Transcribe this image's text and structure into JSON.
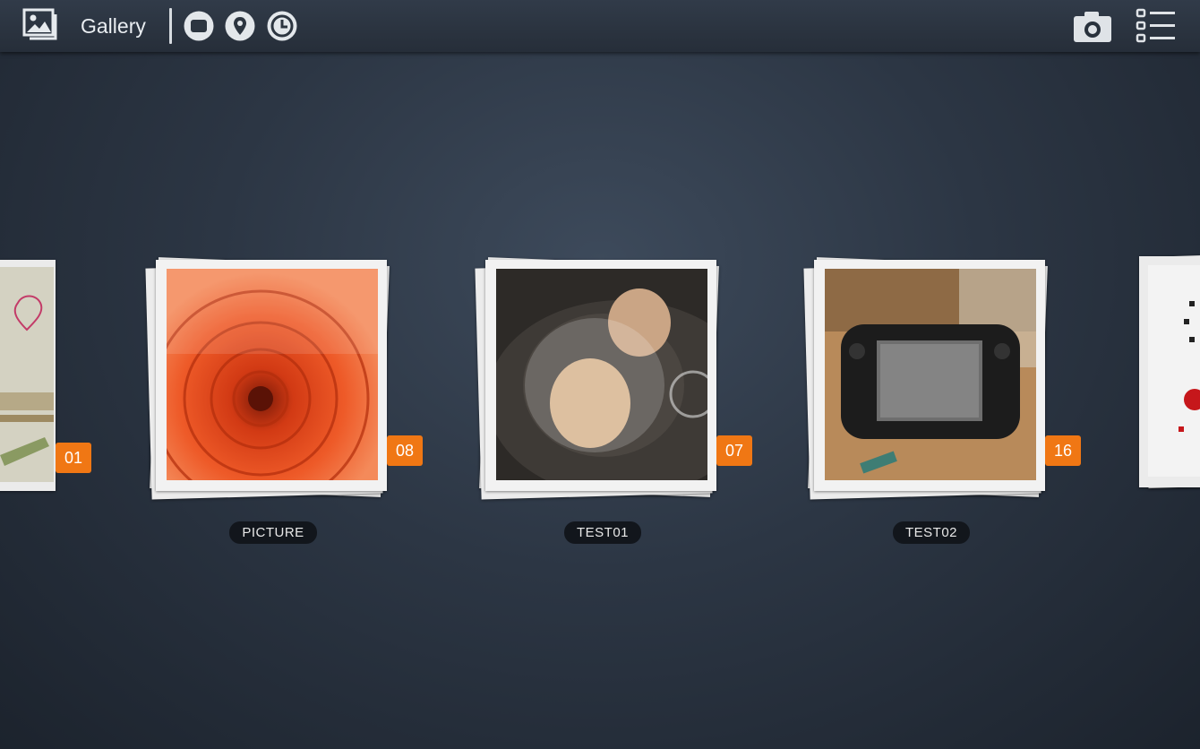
{
  "header": {
    "title": "Gallery",
    "icons": [
      "gallery-icon",
      "albums-view-icon",
      "location-view-icon",
      "time-view-icon",
      "camera-icon",
      "list-menu-icon"
    ]
  },
  "albums": [
    {
      "name": "",
      "count": "01"
    },
    {
      "name": "PICTURE",
      "count": "08"
    },
    {
      "name": "TEST01",
      "count": "07"
    },
    {
      "name": "TEST02",
      "count": "16"
    }
  ],
  "colors": {
    "accent": "#f07714",
    "background": "#2c3644",
    "label_bg": "#12161c"
  }
}
